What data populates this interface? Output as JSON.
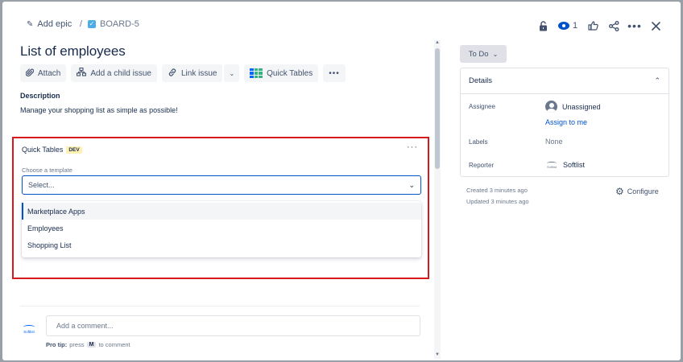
{
  "breadcrumb": {
    "epic_label": "Add epic",
    "separator": "/",
    "issue_key": "BOARD-5"
  },
  "header_actions": {
    "watch_count": "1"
  },
  "issue": {
    "title": "List of employees",
    "description_label": "Description",
    "description_text": "Manage your shopping list as simple as possible!"
  },
  "toolbar": {
    "attach_label": "Attach",
    "child_issue_label": "Add a child issue",
    "link_issue_label": "Link issue",
    "quick_tables_label": "Quick Tables"
  },
  "quick_tables": {
    "title": "Quick Tables",
    "badge": "DEV",
    "template_label": "Choose a template",
    "select_placeholder": "Select...",
    "options": [
      "Marketplace Apps",
      "Employees",
      "Shopping List"
    ]
  },
  "comment": {
    "placeholder": "Add a comment...",
    "protip_prefix": "Pro tip:",
    "protip_press": "press",
    "protip_key": "M",
    "protip_suffix": "to comment",
    "avatar_text": "Softlist"
  },
  "status": {
    "label": "To Do"
  },
  "details": {
    "header": "Details",
    "assignee_label": "Assignee",
    "assignee_value": "Unassigned",
    "assign_link": "Assign to me",
    "labels_label": "Labels",
    "labels_value": "None",
    "reporter_label": "Reporter",
    "reporter_value": "Softlist",
    "reporter_logo_text": "Softlist"
  },
  "meta": {
    "created": "Created 3 minutes ago",
    "updated": "Updated 3 minutes ago",
    "configure_label": "Configure"
  },
  "colors": {
    "accent": "#0052cc",
    "highlight_border": "#d7191c",
    "dev_badge": "#fff0b3"
  }
}
